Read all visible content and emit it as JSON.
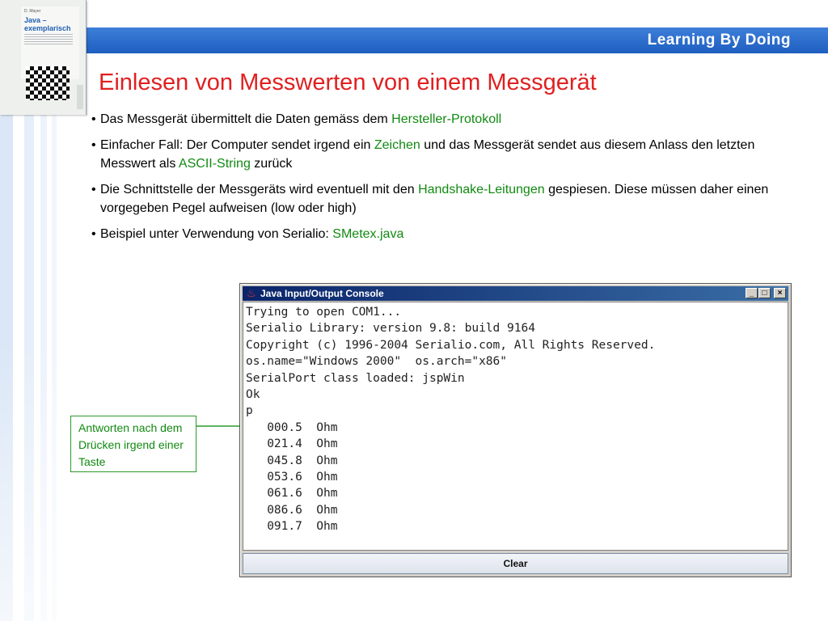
{
  "banner": {
    "title": "Learning By Doing"
  },
  "book": {
    "author": "D. Mayer",
    "title_line1": "Java –",
    "title_line2": "exemplarisch"
  },
  "headline": "Einlesen von Messwerten von einem Messgerät",
  "bullets": [
    {
      "parts": [
        "Das Messgerät übermittelt die Daten gemäss dem ",
        "Hersteller-Protokoll",
        ""
      ]
    },
    {
      "parts": [
        "Einfacher Fall: Der Computer sendet irgend ein ",
        "Zeichen",
        " und das Messgerät sendet aus diesem Anlass den letzten Messwert als "
      ],
      "parts2": [
        "ASCII-String",
        " zurück"
      ]
    },
    {
      "parts": [
        "Die Schnittstelle der Messgeräts wird eventuell mit den ",
        "Handshake-Leitungen",
        " gespiesen. Diese müssen daher einen vorgegeben Pegel aufweisen (low oder high)"
      ]
    },
    {
      "parts": [
        "Beispiel unter Verwendung von Serialio: ",
        "SMetex.java",
        ""
      ]
    }
  ],
  "bullet_symbol": "•",
  "callout": {
    "text": "Antworten nach dem Drücken irgend einer Taste"
  },
  "window": {
    "title": "Java Input/Output Console",
    "controls": {
      "minimize": "_",
      "maximize": "□",
      "close": "×"
    },
    "lines": [
      "Trying to open COM1...",
      "Serialio Library: version 9.8: build 9164",
      "Copyright (c) 1996-2004 Serialio.com, All Rights Reserved.",
      "os.name=\"Windows 2000\"  os.arch=\"x86\"",
      "SerialPort class loaded: jspWin",
      "Ok",
      "p",
      "   000.5  Ohm",
      "   021.4  Ohm",
      "   045.8  Ohm",
      "   053.6  Ohm",
      "   061.6  Ohm",
      "   086.6  Ohm",
      "   091.7  Ohm"
    ],
    "clear_button": "Clear"
  },
  "colors": {
    "banner": "#1e5fc0",
    "headline": "#e02020",
    "highlight": "#118a11",
    "titlebar": "#0a246a"
  }
}
